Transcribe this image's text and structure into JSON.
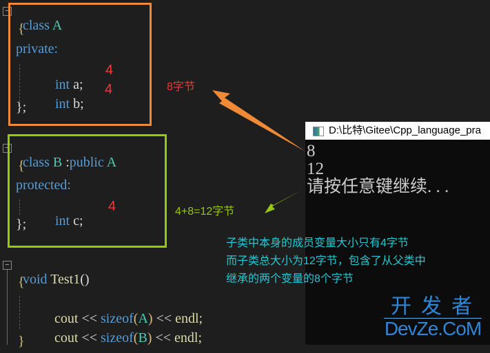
{
  "editor": {
    "class_a": {
      "header_kw": "class",
      "header_name": "A",
      "open_brace": "{",
      "access": "private:",
      "members": [
        {
          "type": "int",
          "decl": "a;",
          "size": "4"
        },
        {
          "type": "int",
          "decl": "b;",
          "size": "4"
        }
      ],
      "close": "};"
    },
    "class_b": {
      "header_kw": "class",
      "header_name": "B",
      "inherit_sep": ":",
      "inherit_kw": "public",
      "base_name": "A",
      "open_brace": "{",
      "access": "protected:",
      "members": [
        {
          "type": "int",
          "decl": "c;",
          "size": "4"
        }
      ],
      "close": "};"
    },
    "test_func": {
      "ret_kw": "void",
      "name": "Test1",
      "parens": "()",
      "open_brace": "{",
      "statements": [
        {
          "cout": "cout",
          "op1": "<<",
          "fn": "sizeof",
          "lp": "(",
          "arg": "A",
          "rp": ")",
          "op2": "<<",
          "endl": "endl;"
        },
        {
          "cout": "cout",
          "op1": "<<",
          "fn": "sizeof",
          "lp": "(",
          "arg": "B",
          "rp": ")",
          "op2": "<<",
          "endl": "endl;"
        }
      ],
      "close": "}"
    },
    "fold_symbol": "−"
  },
  "annotations": {
    "class_a_size": "8字节",
    "class_b_size": "4+8=12字节",
    "explanation": [
      "子类中本身的成员变量大小只有4字节",
      "而子类总大小为12字节，包含了从父类中",
      "继承的两个变量的8个字节"
    ],
    "colors": {
      "class_a_box": "#f08a36",
      "class_b_box": "#98c80c",
      "size_red": "#f03a3a",
      "explanation_cyan": "#22c9d3"
    }
  },
  "console": {
    "title": "D:\\比特\\Gitee\\Cpp_language_pra",
    "output": [
      "8",
      "12",
      "请按任意键继续. . ."
    ]
  },
  "watermark": {
    "top": "开发者",
    "bottom": "DevZe.CoM"
  }
}
